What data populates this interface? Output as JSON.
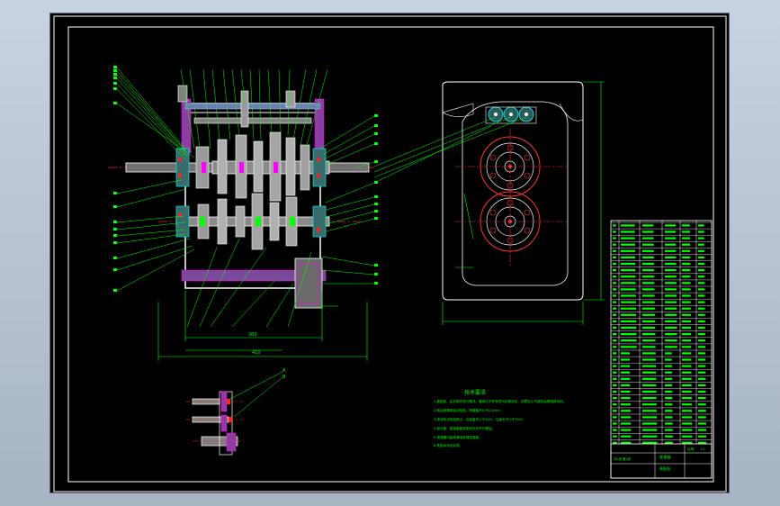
{
  "drawing": {
    "technical_title": "技术要求",
    "technical_notes": [
      "1.装配前，应对零件进行清洗，箱体内不许有任何杂物存在，内壁涂上不被机油侵蚀的涂料；",
      "2.啮合侧隙用铅丝检验，侧隙值不小于0.1mm；",
      "3.用涂色法检验斑点，沿齿高不小于40%，沿齿长不小于50%；",
      "4.剖分面、各接触面及密封处均不许漏油；",
      "5.减速器内装润滑油至规定高度；",
      "6.表面涂灰色油漆。"
    ],
    "title_block": {
      "name": "变速器",
      "drawing_no": "装配图",
      "scale_label": "比例",
      "scale": "1:1",
      "sheet": "共1张 第1张"
    },
    "detail_labels": [
      "A",
      "B"
    ],
    "colors": {
      "background": "#000000",
      "frame": "#ffffff",
      "outline": "#ffffff",
      "leader": "#00ff00",
      "center_line": "#ff2020",
      "part": "#00ffff",
      "section": "#ff00ff",
      "gear_pitch": "#ff3030",
      "dimension": "#00ff00"
    }
  }
}
